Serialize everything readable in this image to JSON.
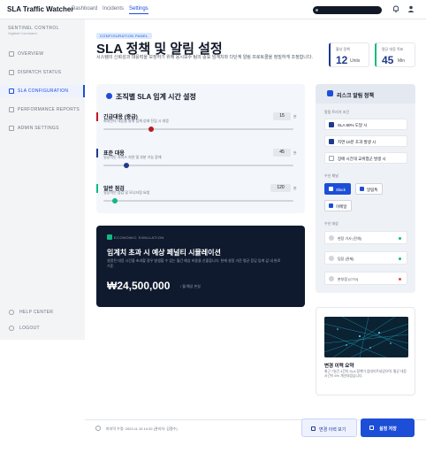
{
  "topbar": {
    "brand": "SLA Traffic Watcher",
    "nav": [
      "Dashboard",
      "Incidents",
      "Settings"
    ]
  },
  "sidebar": {
    "title": "SENTINEL CONTROL",
    "subtitle": "Vigilant Command",
    "items": [
      "OVERVIEW",
      "DISPATCH STATUS",
      "SLA CONFIGURATION",
      "PERFORMANCE REPORTS",
      "ADMIN SETTINGS"
    ],
    "bottom": [
      "HELP CENTER",
      "LOGOUT"
    ]
  },
  "header": {
    "tag": "CONFIGURATION PANEL",
    "title": "SLA 정책 및 알림 설정",
    "description": "시스템의 신뢰성과 대응력을 보장하기 위해 응시보수 팀의 중요 임계치와 다단계 알림 프로토콜을 정밀하게 조정합니다."
  },
  "kpis": [
    {
      "label": "활성 정책",
      "value": "12",
      "unit": "Units",
      "accent": "#1e3a8a"
    },
    {
      "label": "평균 대응 목표",
      "value": "45",
      "unit": "Min",
      "accent": "#10b981"
    }
  ],
  "time_settings": {
    "title": "조직별 SLA 임계 시간 설정",
    "rows": [
      {
        "name": "긴급대응 (중급)",
        "desc": "최대한의 대응을 통해 임계 상태 진입 시 대응",
        "value": "15",
        "unit": "분",
        "color": "#b91c1c",
        "position": 0.25
      },
      {
        "name": "표준 대응",
        "desc": "일상적인 서비스 지연 및 부분 기능 장애",
        "value": "45",
        "unit": "분",
        "color": "#1e3a8a",
        "position": 0.12
      },
      {
        "name": "일반 점검",
        "desc": "일상적인 점검 및 모니터링 요청",
        "value": "120",
        "unit": "분",
        "color": "#10b981",
        "position": 0.06
      }
    ]
  },
  "simulation": {
    "tag": "ECONOMIC SIMULATION",
    "title": "임계치 초과 시 예상 페널티 시뮬레이션",
    "description": "설정된 대응 시간을 초과할 경우 발생할 수 있는 월간 예상 비용을 산출합니다. 현재 설정 기준 평균 응답 임계 값 내 완료 기준.",
    "amount": "₩24,500,000",
    "unit": "/ 월 예상 손실"
  },
  "risk": {
    "title": "리스크 알림 정책",
    "conditions_label": "알림 트리거 조건",
    "conditions": [
      {
        "text": "SLA 80% 도달 시",
        "checked": true
      },
      {
        "text": "지연 10분 초과 발생 시",
        "checked": true
      },
      {
        "text": "장애 시간대 교위험군 발생 시",
        "checked": false
      }
    ],
    "channels_label": "수신 채널",
    "channels": [
      {
        "text": "Slack",
        "active": true
      },
      {
        "text": "알림톡",
        "active": false
      },
      {
        "text": "이메일",
        "active": false
      }
    ],
    "recipients_label": "수신 대상",
    "recipients": [
      {
        "name": "현장 기사 (전체)",
        "status_color": "#10b981"
      },
      {
        "name": "팀장 (관제)",
        "status_color": "#10b981"
      },
      {
        "name": "본부장 (CTO)",
        "status_color": "#ef4444"
      }
    ]
  },
  "history": {
    "title": "변경 이력 요약",
    "description": "최근 7일간 4건의 SLA 정책이 업데이트되었으며, 평균 대응 시간이 6% 개선되었습니다."
  },
  "footer": {
    "last_modified": "마지막 수정: 2023.11.15 14:32 (관리자: 김철수)",
    "history_button": "변경 이력 보기",
    "save_button": "설정 저장"
  }
}
